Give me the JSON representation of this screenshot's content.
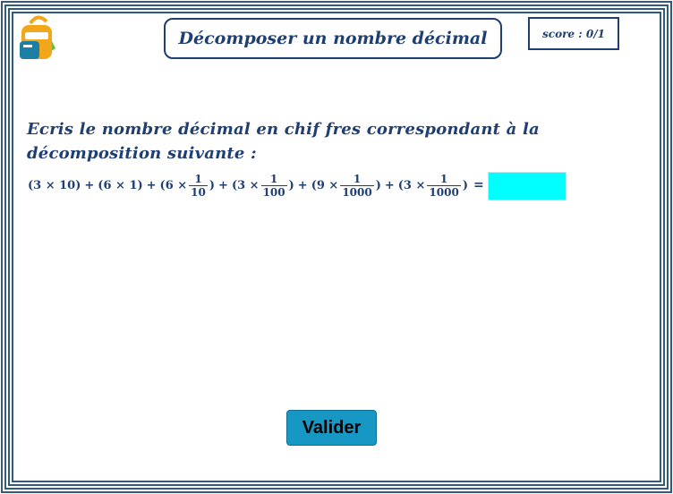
{
  "header": {
    "title": "Décomposer un nombre décimal",
    "score": "score : 0/1",
    "logo_icon": "backpack-icon"
  },
  "exercise": {
    "instruction_line1": "Ecris le nombre décimal en chif fres correspondant à la",
    "instruction_line2": "décomposition suivante :",
    "terms": [
      {
        "text": "(3 × 10)"
      },
      {
        "text": "(6 × 1)"
      },
      {
        "open": "(6 ×",
        "num": "1",
        "den": "10",
        "close": ")"
      },
      {
        "open": "(3 ×",
        "num": "1",
        "den": "100",
        "close": ")"
      },
      {
        "open": "(9 ×",
        "num": "1",
        "den": "1000",
        "close": ")"
      },
      {
        "open": "(3 ×",
        "num": "1",
        "den": "1000",
        "close": ")"
      }
    ],
    "plus": "+",
    "equals": "=",
    "answer_value": ""
  },
  "actions": {
    "validate_label": "Valider"
  },
  "colors": {
    "primary_text": "#1f3e72",
    "answer_background": "#00ffff",
    "button_background": "#1797c4",
    "frame": "#2f5b7c"
  }
}
